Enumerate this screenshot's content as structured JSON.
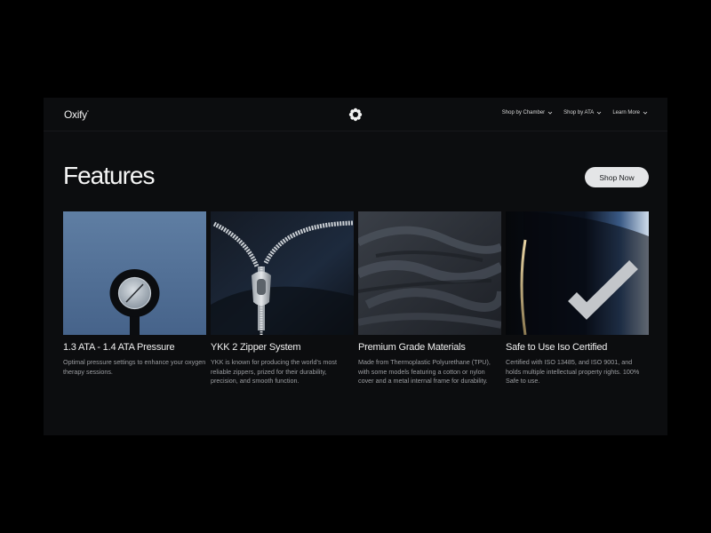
{
  "nav": {
    "logo": "Oxify",
    "logo_mark": "°",
    "links": [
      {
        "label": "Shop by Chamber"
      },
      {
        "label": "Shop by ATA"
      },
      {
        "label": "Learn More"
      }
    ]
  },
  "page": {
    "title": "Features",
    "cta_label": "Shop Now"
  },
  "cards": [
    {
      "title": "1.3 ATA - 1.4 ATA Pressure",
      "description": "Optimal pressure settings to enhance your oxygen therapy sessions.",
      "image": "pressure-gauge"
    },
    {
      "title": "YKK 2 Zipper System",
      "description": "YKK is known for producing the world's most reliable zippers, prized for their durability, precision, and smooth function.",
      "image": "zipper"
    },
    {
      "title": "Premium Grade Materials",
      "description": "Made from Thermoplastic Polyurethane (TPU), with some models featuring a cotton or nylon cover and a metal internal frame for durability.",
      "image": "fabric"
    },
    {
      "title": "Safe to Use Iso Certified",
      "description": "Certified with ISO 13485, and ISO 9001, and holds multiple intellectual property rights. 100% Safe to use.",
      "image": "checkmark"
    }
  ],
  "colors": {
    "background": "#000000",
    "panel": "#0c0d0f",
    "button": "#e4e5e7",
    "text": "#f0f0f0",
    "muted": "#9b9da1"
  }
}
